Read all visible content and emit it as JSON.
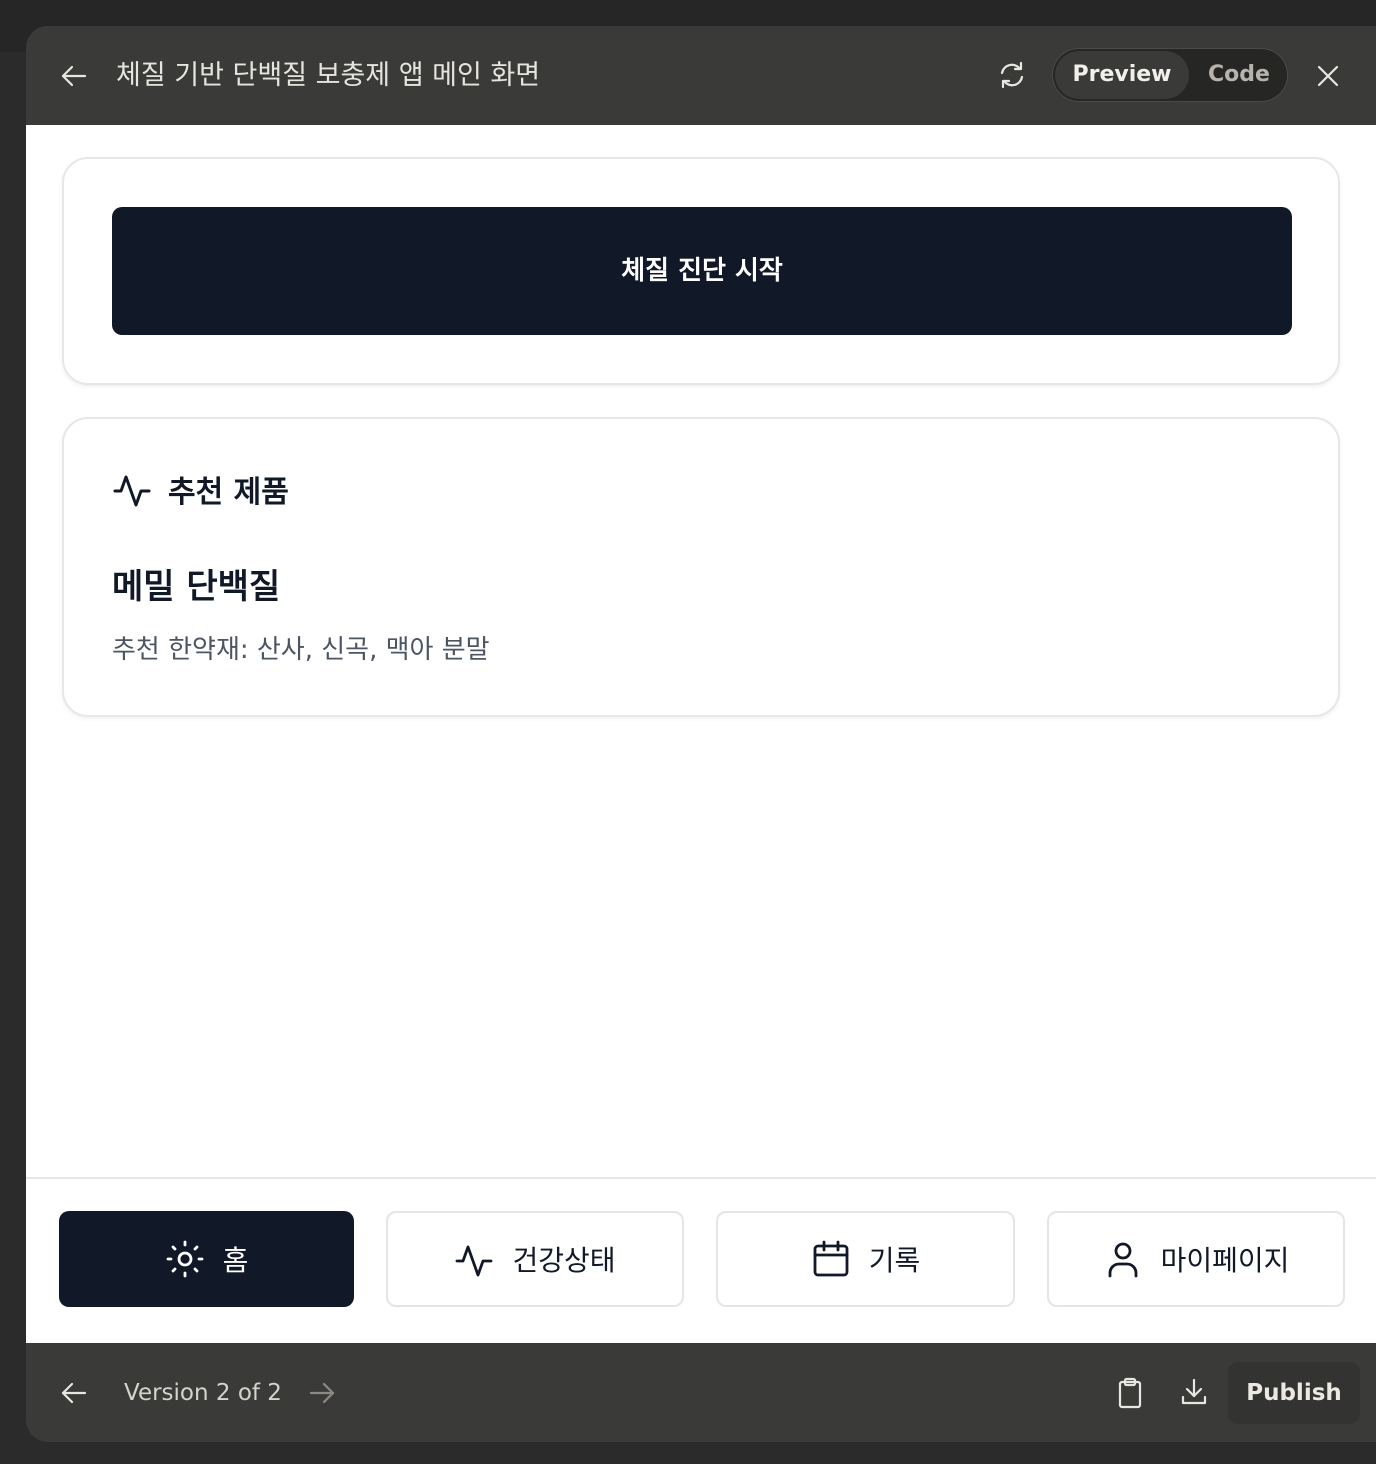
{
  "header": {
    "title": "체질 기반 단백질 보충제 앱 메인 화면",
    "toggle_preview": "Preview",
    "toggle_code": "Code"
  },
  "cta": {
    "label": "체질 진단 시작"
  },
  "recommendation": {
    "heading": "추천 제품",
    "product_name": "메밀 단백질",
    "product_desc": "추천 한약재: 산사, 신곡, 맥아 분말"
  },
  "nav": {
    "home": "홈",
    "health": "건강상태",
    "log": "기록",
    "mypage": "마이페이지",
    "active": "home"
  },
  "footer": {
    "version": "Version 2 of 2",
    "publish": "Publish"
  },
  "colors": {
    "primary_dark": "#111827",
    "chrome": "#3a3a39"
  }
}
